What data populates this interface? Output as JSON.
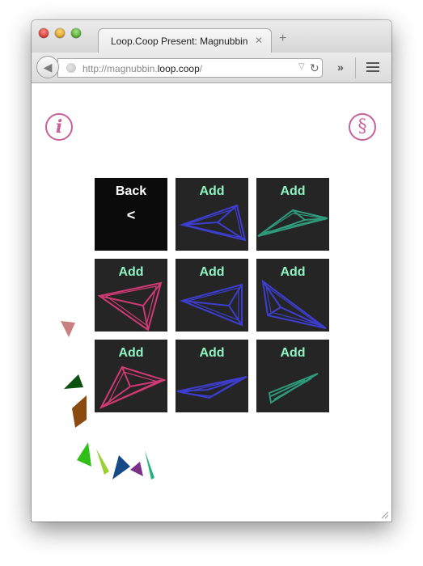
{
  "browser": {
    "tab_title": "Loop.Coop Present: Magnubbin",
    "tab_close": "✕",
    "new_tab": "+",
    "url_prefix": "http://magnubbin.",
    "url_domain": "loop.coop",
    "url_suffix": "/",
    "overflow": "»"
  },
  "page": {
    "info_icon": "i",
    "section_icon": "§",
    "accent_color": "#c8609a",
    "tiles": [
      {
        "label": "Back",
        "sub": "<",
        "kind": "back"
      },
      {
        "label": "Add",
        "color": "#3d3dcf"
      },
      {
        "label": "Add",
        "color": "#2f9a7c"
      },
      {
        "label": "Add",
        "color": "#d03a74"
      },
      {
        "label": "Add",
        "color": "#3d3dcf"
      },
      {
        "label": "Add",
        "color": "#3d3dcf"
      },
      {
        "label": "Add",
        "color": "#d03a74"
      },
      {
        "label": "Add",
        "color": "#3d3dcf"
      },
      {
        "label": "Add",
        "color": "#2f9a7c"
      }
    ],
    "pieces_colors": [
      "#c98080",
      "#0b5210",
      "#8b4a10",
      "#2fbf17",
      "#9ad02f",
      "#154a86",
      "#7b2f86",
      "#23b07a"
    ]
  }
}
